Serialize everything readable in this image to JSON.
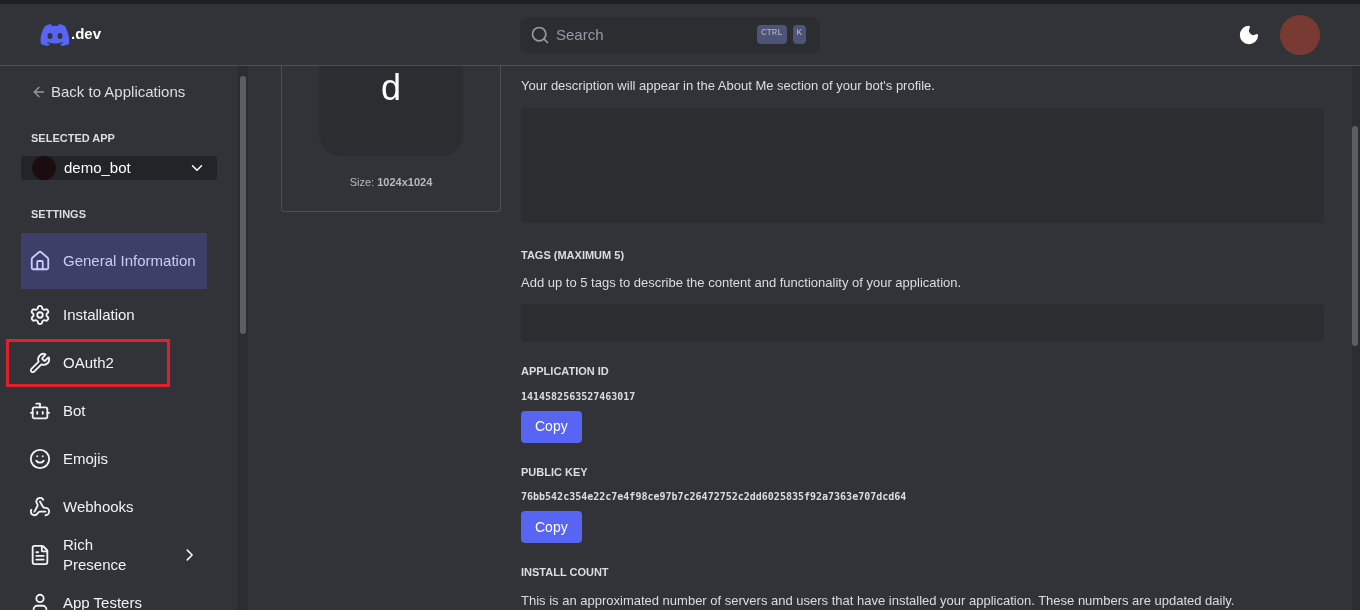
{
  "header": {
    "logo_text": ".dev",
    "search": {
      "placeholder": "Search",
      "keys": [
        "CTRL",
        "K"
      ]
    }
  },
  "sidebar": {
    "back_link": "Back to Applications",
    "selected_app_heading": "SELECTED APP",
    "app": {
      "name": "demo_bot"
    },
    "settings_heading": "SETTINGS",
    "items": [
      {
        "label": "General Information",
        "selected": true,
        "highlighted": false,
        "submenu": false
      },
      {
        "label": "Installation",
        "selected": false,
        "highlighted": false,
        "submenu": false
      },
      {
        "label": "OAuth2",
        "selected": false,
        "highlighted": true,
        "submenu": false
      },
      {
        "label": "Bot",
        "selected": false,
        "highlighted": false,
        "submenu": false
      },
      {
        "label": "Emojis",
        "selected": false,
        "highlighted": false,
        "submenu": false
      },
      {
        "label": "Webhooks",
        "selected": false,
        "highlighted": false,
        "submenu": false
      },
      {
        "label": "Rich Presence",
        "selected": false,
        "highlighted": false,
        "submenu": true
      },
      {
        "label": "App Testers",
        "selected": false,
        "highlighted": false,
        "submenu": false
      }
    ]
  },
  "icon_card": {
    "letter": "d",
    "size_label": "Size:",
    "size_value": "1024x1024"
  },
  "form": {
    "description_hint": "Your description will appear in the About Me section of your bot's profile.",
    "tags_heading": "TAGS (MAXIMUM 5)",
    "tags_hint": "Add up to 5 tags to describe the content and functionality of your application.",
    "fields": [
      {
        "heading": "APPLICATION ID",
        "value": "1414582563527463017",
        "button": "Copy"
      },
      {
        "heading": "PUBLIC KEY",
        "value": "76bb542c354e22c7e4f98ce97b7c26472752c2dd6025835f92a7363e707dcd64",
        "button": "Copy"
      }
    ],
    "install_heading": "INSTALL COUNT",
    "install_hint": "This is an approximated number of servers and users that have installed your application. These numbers are updated daily."
  }
}
